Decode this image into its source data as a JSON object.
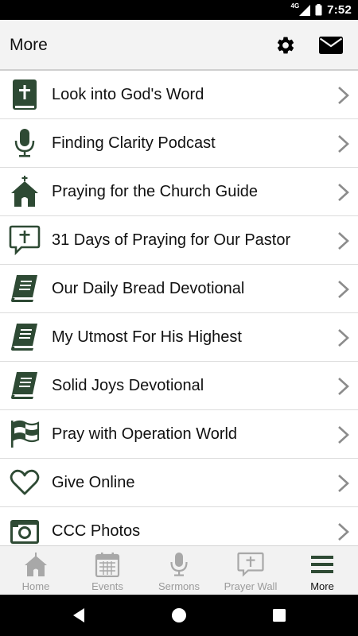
{
  "status_bar": {
    "network": "4G",
    "time": "7:52"
  },
  "header": {
    "title": "More",
    "settings_icon": "gear-icon",
    "mail_icon": "mail-icon"
  },
  "colors": {
    "accent": "#2e4a34",
    "tab_inactive": "#a8a8a8",
    "chevron": "#8c8c8c"
  },
  "menu": {
    "items": [
      {
        "label": "Look into God's Word",
        "icon": "bible-icon"
      },
      {
        "label": "Finding Clarity Podcast",
        "icon": "microphone-icon"
      },
      {
        "label": "Praying for the Church Guide",
        "icon": "church-icon"
      },
      {
        "label": "31 Days of Praying for Our Pastor",
        "icon": "prayer-bubble-icon"
      },
      {
        "label": "Our Daily Bread Devotional",
        "icon": "book-icon"
      },
      {
        "label": "My Utmost For His Highest",
        "icon": "book-icon"
      },
      {
        "label": "Solid Joys Devotional",
        "icon": "book-icon"
      },
      {
        "label": "Pray with Operation World",
        "icon": "flag-icon"
      },
      {
        "label": "Give Online",
        "icon": "heart-icon"
      },
      {
        "label": "CCC Photos",
        "icon": "camera-icon"
      }
    ]
  },
  "tabs": [
    {
      "label": "Home",
      "icon": "home-icon",
      "active": false
    },
    {
      "label": "Events",
      "icon": "calendar-icon",
      "active": false
    },
    {
      "label": "Sermons",
      "icon": "microphone-icon",
      "active": false
    },
    {
      "label": "Prayer Wall",
      "icon": "prayer-bubble-icon",
      "active": false
    },
    {
      "label": "More",
      "icon": "menu-icon",
      "active": true
    }
  ]
}
